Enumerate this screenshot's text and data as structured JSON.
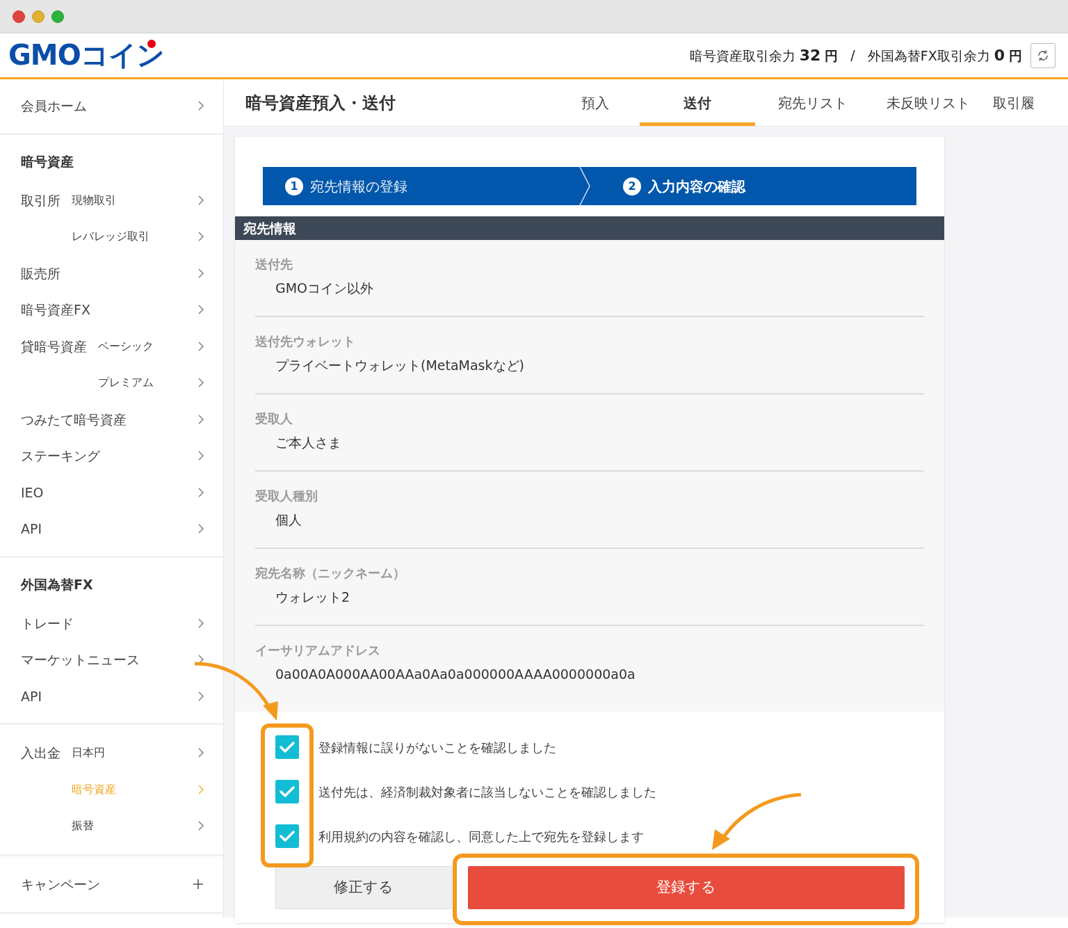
{
  "header": {
    "logo": "GMOコイン",
    "balances": [
      {
        "label": "暗号資産取引余力",
        "value": "32",
        "unit": "円"
      },
      {
        "label": "外国為替FX取引余力",
        "value": "0",
        "unit": "円"
      }
    ],
    "separator": "/"
  },
  "sidebar": [
    {
      "items": [
        {
          "label": "会員ホーム",
          "kind": "link",
          "selected": false
        }
      ]
    },
    {
      "heading": "暗号資産",
      "items": [
        {
          "label": "取引所",
          "sub": "現物取引",
          "kind": "link",
          "selected": false
        },
        {
          "sub": "レバレッジ取引",
          "kind": "link",
          "selected": false
        },
        {
          "label": "販売所",
          "kind": "link",
          "selected": false
        },
        {
          "label": "暗号資産FX",
          "kind": "link",
          "selected": false
        },
        {
          "label": "貸暗号資産",
          "sub": "ベーシック",
          "kind": "link",
          "selected": false
        },
        {
          "sub": "プレミアム",
          "kind": "link",
          "selected": false
        },
        {
          "label": "つみたて暗号資産",
          "kind": "link",
          "selected": false
        },
        {
          "label": "ステーキング",
          "kind": "link",
          "selected": false
        },
        {
          "label": "IEO",
          "kind": "link",
          "selected": false
        },
        {
          "label": "API",
          "kind": "link",
          "selected": false
        }
      ]
    },
    {
      "heading": "外国為替FX",
      "items": [
        {
          "label": "トレード",
          "kind": "link",
          "selected": false
        },
        {
          "label": "マーケットニュース",
          "kind": "link",
          "selected": false
        },
        {
          "label": "API",
          "kind": "link",
          "selected": false
        }
      ]
    },
    {
      "items": [
        {
          "label": "入出金",
          "sub": "日本円",
          "kind": "link",
          "selected": false
        },
        {
          "sub": "暗号資産",
          "kind": "link",
          "selected": true
        },
        {
          "sub": "振替",
          "kind": "link",
          "selected": false
        }
      ]
    },
    {
      "items": [
        {
          "label": "キャンペーン",
          "kind": "expand",
          "selected": false
        }
      ]
    }
  ],
  "page_title": "暗号資産預入・送付",
  "tabs": [
    {
      "label": "預入",
      "selected": false
    },
    {
      "label": "送付",
      "selected": true
    },
    {
      "label": "宛先リスト",
      "selected": false
    },
    {
      "label": "未反映リスト",
      "selected": false
    },
    {
      "label": "取引履",
      "selected": false
    }
  ],
  "steps": [
    {
      "number": "1",
      "label": "宛先情報の登録",
      "selected": false
    },
    {
      "number": "2",
      "label": "入力内容の確認",
      "selected": true
    }
  ],
  "section_title": "宛先情報",
  "fields": [
    {
      "label": "送付先",
      "value": "GMOコイン以外"
    },
    {
      "label": "送付先ウォレット",
      "value": "プライベートウォレット(MetaMaskなど)"
    },
    {
      "label": "受取人",
      "value": "ご本人さま"
    },
    {
      "label": "受取人種別",
      "value": "個人"
    },
    {
      "label": "宛先名称（ニックネーム）",
      "value": "ウォレット2"
    },
    {
      "label": "イーサリアムアドレス",
      "value": "0a00A0A000AA00AAa0Aa0a000000AAAA0000000a0a"
    }
  ],
  "confirmations": [
    {
      "label": "登録情報に誤りがないことを確認しました",
      "checked": true
    },
    {
      "label": "送付先は、経済制裁対象者に該当しないことを確認しました",
      "checked": true
    },
    {
      "label": "利用規約の内容を確認し、同意した上で宛先を登録します",
      "checked": true
    }
  ],
  "buttons": [
    {
      "label": "修正する",
      "kind": "secondary"
    },
    {
      "label": "登録する",
      "kind": "primary"
    }
  ]
}
